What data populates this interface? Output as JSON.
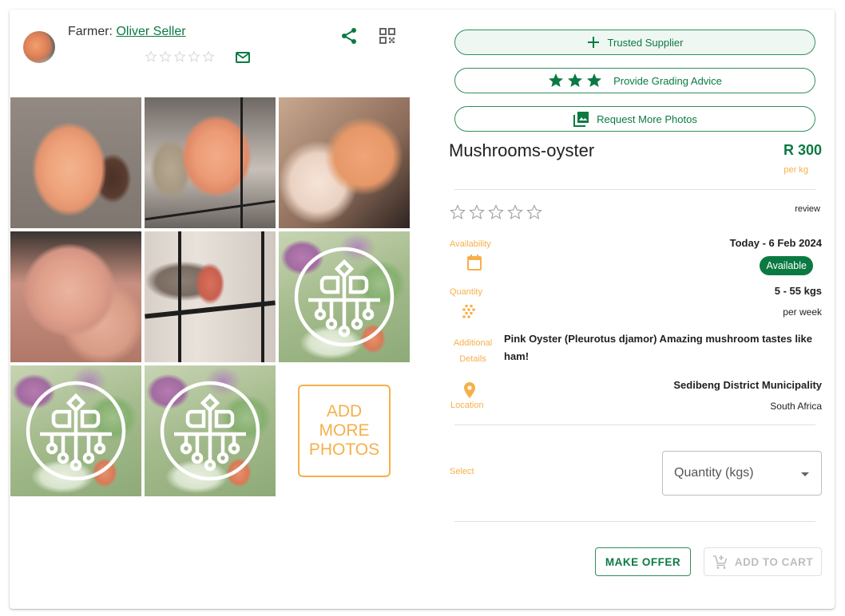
{
  "seller": {
    "farmer_prefix": "Farmer: ",
    "farmer_name": "Oliver Seller",
    "rating": 0,
    "rating_max": 5
  },
  "header_icons": {
    "share": "share-icon",
    "qr": "qr-code-icon",
    "mail": "mail-icon"
  },
  "gallery": {
    "photos": [
      {
        "kind": "photo",
        "alt": "Pink oyster mushroom cluster held in hand"
      },
      {
        "kind": "photo",
        "alt": "Pink oyster mushrooms growing from bag"
      },
      {
        "kind": "photo",
        "alt": "Close-up of pink oyster mushrooms"
      },
      {
        "kind": "photo",
        "alt": "Pink oyster mushroom caps close-up"
      },
      {
        "kind": "photo",
        "alt": "Mushroom grow bag on shelf"
      },
      {
        "kind": "placeholder",
        "alt": "Placeholder logo on vegetables"
      },
      {
        "kind": "placeholder",
        "alt": "Placeholder logo on vegetables"
      },
      {
        "kind": "placeholder",
        "alt": "Placeholder logo on vegetables"
      }
    ],
    "add_more_lines": [
      "ADD",
      "MORE",
      "PHOTOS"
    ]
  },
  "actions": {
    "trusted_supplier": "Trusted Supplier",
    "grading_advice": "Provide Grading Advice",
    "request_photos": "Request More Photos"
  },
  "product": {
    "title": "Mushrooms-oyster",
    "price": "R 300",
    "price_unit": "per kg",
    "rating": 0,
    "rating_max": 5,
    "review_label": "review",
    "availability_label": "Availability",
    "availability_range": "Today - 6 Feb 2024",
    "availability_status": "Available",
    "quantity_label": "Quantity",
    "quantity_range": "5 - 55 kgs",
    "quantity_period": "per week",
    "details_label_1": "Additional",
    "details_label_2": "Details",
    "details_text": "Pink Oyster (Pleurotus djamor) Amazing mushroom tastes like ham!",
    "location_label": "Location",
    "location_region": "Sedibeng District Municipality",
    "location_country": "South Africa"
  },
  "order": {
    "select_label": "Select",
    "quantity_select_placeholder": "Quantity (kgs)",
    "make_offer": "MAKE OFFER",
    "add_to_cart": "ADD TO CART"
  },
  "colors": {
    "brand_green": "#0b7a42",
    "accent_orange": "#f6b04a",
    "disabled_grey": "#bdbdbd"
  }
}
